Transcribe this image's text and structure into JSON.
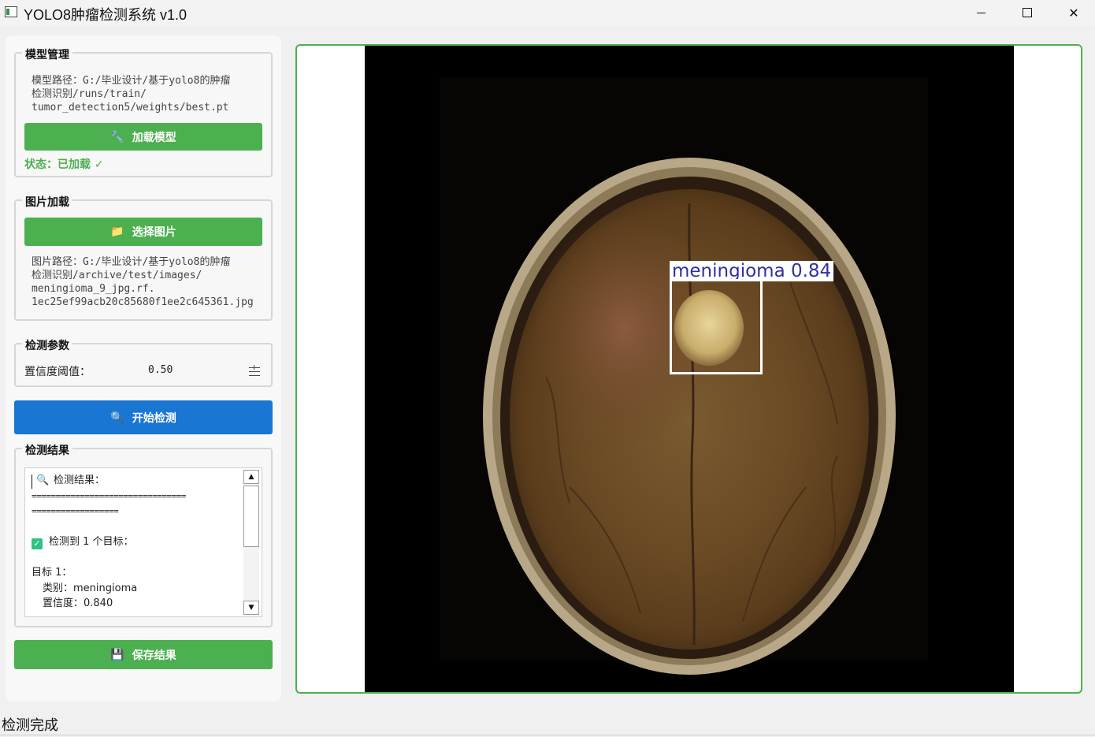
{
  "window": {
    "title": "YOLO8肿瘤检测系统 v1.0",
    "minimize": "—",
    "maximize": "☐",
    "close": "✕"
  },
  "model_group": {
    "title": "模型管理",
    "path_lines": [
      "模型路径：G:/毕业设计/基于yolo8的肿瘤",
      "检测识别/runs/train/",
      "tumor_detection5/weights/best.pt"
    ],
    "load_button": "加载模型",
    "load_icon": "🔧",
    "status": "状态：已加载 ✓"
  },
  "image_group": {
    "title": "图片加载",
    "select_button": "选择图片",
    "select_icon": "📁",
    "path_lines": [
      "图片路径：G:/毕业设计/基于yolo8的肿瘤",
      "检测识别/archive/test/images/",
      "meningioma_9_jpg.rf.",
      "1ec25ef99acb20c85680f1ee2c645361.jpg"
    ]
  },
  "params_group": {
    "title": "检测参数",
    "confidence_label": "置信度阈值：",
    "confidence_value": "0.50"
  },
  "detect_button": {
    "label": "开始检测",
    "icon": "🔍"
  },
  "results_group": {
    "title": "检测结果",
    "heading": "检测结果：",
    "separator_1": "================================",
    "separator_2": "==================",
    "count_line": "检测到 1 个目标：",
    "target_title": "目标 1：",
    "class_line": "  类别：meningioma",
    "conf_line": "  置信度：0.840"
  },
  "save_button": {
    "label": "保存结果",
    "icon": "💾"
  },
  "detection": {
    "label": "meningioma 0.84"
  },
  "statusbar": {
    "text": "检测完成"
  },
  "colors": {
    "accent_green": "#4caf50",
    "accent_blue": "#1976d2"
  },
  "icons": {
    "search": "search-icon",
    "check": "check-icon",
    "folder": "folder-icon",
    "wrench": "wrench-icon",
    "disk": "save-icon"
  }
}
